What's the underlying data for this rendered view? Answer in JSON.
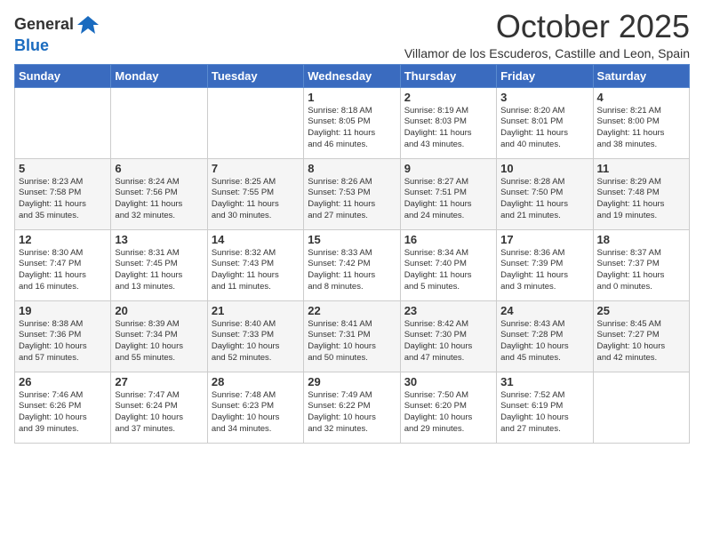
{
  "logo": {
    "general": "General",
    "blue": "Blue"
  },
  "header": {
    "title": "October 2025",
    "location": "Villamor de los Escuderos, Castille and Leon, Spain"
  },
  "days_of_week": [
    "Sunday",
    "Monday",
    "Tuesday",
    "Wednesday",
    "Thursday",
    "Friday",
    "Saturday"
  ],
  "weeks": [
    [
      {
        "day": "",
        "info": ""
      },
      {
        "day": "",
        "info": ""
      },
      {
        "day": "",
        "info": ""
      },
      {
        "day": "1",
        "info": "Sunrise: 8:18 AM\nSunset: 8:05 PM\nDaylight: 11 hours\nand 46 minutes."
      },
      {
        "day": "2",
        "info": "Sunrise: 8:19 AM\nSunset: 8:03 PM\nDaylight: 11 hours\nand 43 minutes."
      },
      {
        "day": "3",
        "info": "Sunrise: 8:20 AM\nSunset: 8:01 PM\nDaylight: 11 hours\nand 40 minutes."
      },
      {
        "day": "4",
        "info": "Sunrise: 8:21 AM\nSunset: 8:00 PM\nDaylight: 11 hours\nand 38 minutes."
      }
    ],
    [
      {
        "day": "5",
        "info": "Sunrise: 8:23 AM\nSunset: 7:58 PM\nDaylight: 11 hours\nand 35 minutes."
      },
      {
        "day": "6",
        "info": "Sunrise: 8:24 AM\nSunset: 7:56 PM\nDaylight: 11 hours\nand 32 minutes."
      },
      {
        "day": "7",
        "info": "Sunrise: 8:25 AM\nSunset: 7:55 PM\nDaylight: 11 hours\nand 30 minutes."
      },
      {
        "day": "8",
        "info": "Sunrise: 8:26 AM\nSunset: 7:53 PM\nDaylight: 11 hours\nand 27 minutes."
      },
      {
        "day": "9",
        "info": "Sunrise: 8:27 AM\nSunset: 7:51 PM\nDaylight: 11 hours\nand 24 minutes."
      },
      {
        "day": "10",
        "info": "Sunrise: 8:28 AM\nSunset: 7:50 PM\nDaylight: 11 hours\nand 21 minutes."
      },
      {
        "day": "11",
        "info": "Sunrise: 8:29 AM\nSunset: 7:48 PM\nDaylight: 11 hours\nand 19 minutes."
      }
    ],
    [
      {
        "day": "12",
        "info": "Sunrise: 8:30 AM\nSunset: 7:47 PM\nDaylight: 11 hours\nand 16 minutes."
      },
      {
        "day": "13",
        "info": "Sunrise: 8:31 AM\nSunset: 7:45 PM\nDaylight: 11 hours\nand 13 minutes."
      },
      {
        "day": "14",
        "info": "Sunrise: 8:32 AM\nSunset: 7:43 PM\nDaylight: 11 hours\nand 11 minutes."
      },
      {
        "day": "15",
        "info": "Sunrise: 8:33 AM\nSunset: 7:42 PM\nDaylight: 11 hours\nand 8 minutes."
      },
      {
        "day": "16",
        "info": "Sunrise: 8:34 AM\nSunset: 7:40 PM\nDaylight: 11 hours\nand 5 minutes."
      },
      {
        "day": "17",
        "info": "Sunrise: 8:36 AM\nSunset: 7:39 PM\nDaylight: 11 hours\nand 3 minutes."
      },
      {
        "day": "18",
        "info": "Sunrise: 8:37 AM\nSunset: 7:37 PM\nDaylight: 11 hours\nand 0 minutes."
      }
    ],
    [
      {
        "day": "19",
        "info": "Sunrise: 8:38 AM\nSunset: 7:36 PM\nDaylight: 10 hours\nand 57 minutes."
      },
      {
        "day": "20",
        "info": "Sunrise: 8:39 AM\nSunset: 7:34 PM\nDaylight: 10 hours\nand 55 minutes."
      },
      {
        "day": "21",
        "info": "Sunrise: 8:40 AM\nSunset: 7:33 PM\nDaylight: 10 hours\nand 52 minutes."
      },
      {
        "day": "22",
        "info": "Sunrise: 8:41 AM\nSunset: 7:31 PM\nDaylight: 10 hours\nand 50 minutes."
      },
      {
        "day": "23",
        "info": "Sunrise: 8:42 AM\nSunset: 7:30 PM\nDaylight: 10 hours\nand 47 minutes."
      },
      {
        "day": "24",
        "info": "Sunrise: 8:43 AM\nSunset: 7:28 PM\nDaylight: 10 hours\nand 45 minutes."
      },
      {
        "day": "25",
        "info": "Sunrise: 8:45 AM\nSunset: 7:27 PM\nDaylight: 10 hours\nand 42 minutes."
      }
    ],
    [
      {
        "day": "26",
        "info": "Sunrise: 7:46 AM\nSunset: 6:26 PM\nDaylight: 10 hours\nand 39 minutes."
      },
      {
        "day": "27",
        "info": "Sunrise: 7:47 AM\nSunset: 6:24 PM\nDaylight: 10 hours\nand 37 minutes."
      },
      {
        "day": "28",
        "info": "Sunrise: 7:48 AM\nSunset: 6:23 PM\nDaylight: 10 hours\nand 34 minutes."
      },
      {
        "day": "29",
        "info": "Sunrise: 7:49 AM\nSunset: 6:22 PM\nDaylight: 10 hours\nand 32 minutes."
      },
      {
        "day": "30",
        "info": "Sunrise: 7:50 AM\nSunset: 6:20 PM\nDaylight: 10 hours\nand 29 minutes."
      },
      {
        "day": "31",
        "info": "Sunrise: 7:52 AM\nSunset: 6:19 PM\nDaylight: 10 hours\nand 27 minutes."
      },
      {
        "day": "",
        "info": ""
      }
    ]
  ]
}
